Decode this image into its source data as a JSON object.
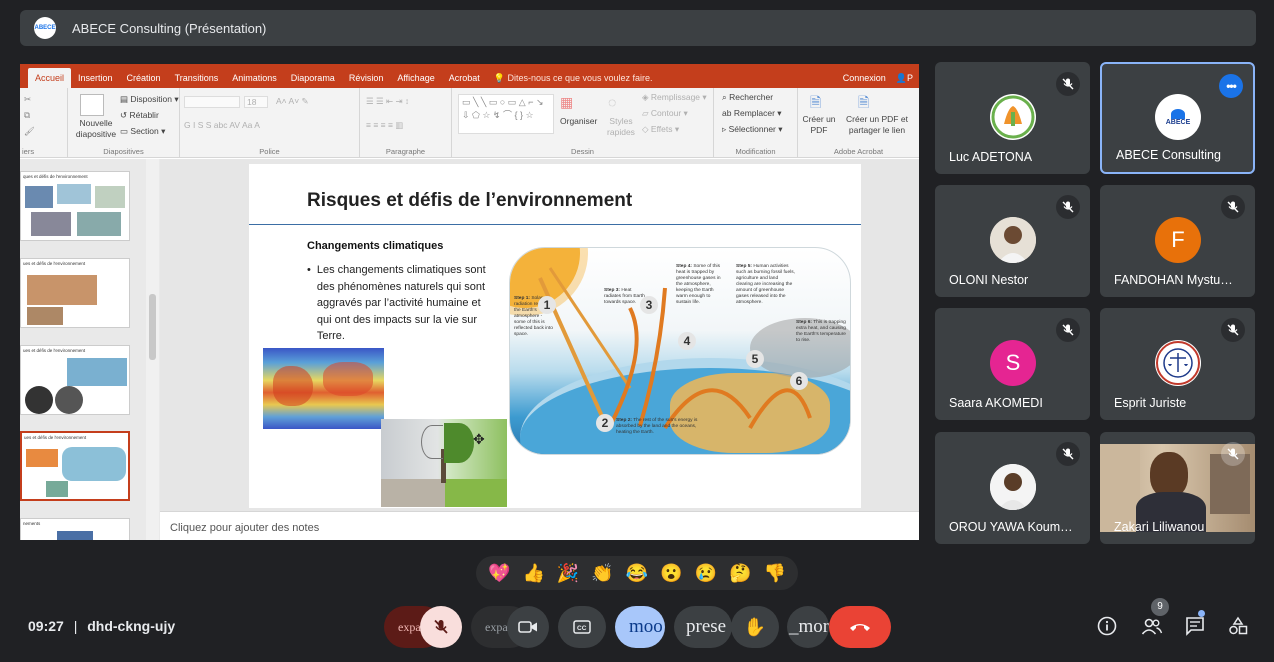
{
  "meeting": {
    "title": "ABECE Consulting (Présentation)",
    "time": "09:27",
    "separator": "|",
    "code": "dhd-ckng-ujy"
  },
  "ppt": {
    "tabs": [
      "Accueil",
      "Insertion",
      "Création",
      "Transitions",
      "Animations",
      "Diaporama",
      "Révision",
      "Affichage",
      "Acrobat"
    ],
    "search_hint": "Dites-nous ce que vous voulez faire.",
    "connect": "Connexion",
    "share_letter": "P",
    "ribbon": {
      "paste_group": "iers",
      "new_slide": "Nouvelle diapositive",
      "layout": "Disposition",
      "reset": "Rétablir",
      "section": "Section",
      "slides_group": "Diapositives",
      "font_group": "Police",
      "font_size": "18",
      "font_btns": "G  I  S  S  abc  AV  Aa  A",
      "para_group": "Paragraphe",
      "organize": "Organiser",
      "quick_styles": "Styles rapides",
      "fill": "Remplissage",
      "outline": "Contour",
      "effects": "Effets",
      "draw_group": "Dessin",
      "find": "Rechercher",
      "replace": "Remplacer",
      "select": "Sélectionner",
      "edit_group": "Modification",
      "create_pdf": "Créer un PDF",
      "create_pdf_share": "Créer un PDF et partager le lien",
      "acrobat_group": "Adobe Acrobat"
    },
    "thumbs": [
      {
        "title": "ques et défis de l'environnement"
      },
      {
        "title": "ues et défis de l'environnement"
      },
      {
        "title": "ues et défis de l'environnement"
      },
      {
        "title": "ues et défis de l'environnement"
      },
      {
        "title": "nements"
      }
    ],
    "slide": {
      "title": "Risques et défis de l’environnement",
      "subtitle": "Changements climatiques",
      "bullet": "Les changements climatiques sont des phénomènes naturels qui sont aggravés par l’activité humaine et qui ont des impacts sur la vie sur Terre.",
      "steps": [
        {
          "num": "1",
          "label": "Step 1:",
          "text": "Solar radiation reaches the Earth's atmosphere - some of this is reflected back into space."
        },
        {
          "num": "2",
          "label": "Step 2:",
          "text": "The rest of the sun's energy is absorbed by the land and the oceans, heating the Earth."
        },
        {
          "num": "3",
          "label": "Step 3:",
          "text": "Heat radiates from Earth towards space."
        },
        {
          "num": "4",
          "label": "Step 4:",
          "text": "Some of this heat is trapped by greenhouse gases in the atmosphere, keeping the Earth warm enough to sustain life."
        },
        {
          "num": "5",
          "label": "Step 5:",
          "text": "Human activities such as burning fossil fuels, agriculture and land clearing are increasing the amount of greenhouse gases released into the atmosphere."
        },
        {
          "num": "6",
          "label": "Step 6:",
          "text": "This is trapping extra heat, and causing the Earth's temperature to rise."
        }
      ]
    },
    "notes": "Cliquez pour ajouter des notes"
  },
  "participants": [
    {
      "name": "Luc ADETONA",
      "avatar": "logo",
      "color": "#ffffff",
      "muted": true
    },
    {
      "name": "ABECE Consulting",
      "avatar": "logo",
      "color": "#ffffff",
      "muted": false,
      "presenting": true,
      "logo_text": "ABECE"
    },
    {
      "name": "OLONI Nestor",
      "avatar": "photo",
      "color": "#d9d0c3",
      "muted": true
    },
    {
      "name": "FANDOHAN Mystu…",
      "avatar": "letter",
      "letter": "F",
      "color": "#e8710a",
      "muted": true
    },
    {
      "name": "Saara AKOMEDI",
      "avatar": "letter",
      "letter": "S",
      "color": "#e52592",
      "muted": true
    },
    {
      "name": "Esprit Juriste",
      "avatar": "logo",
      "color": "#ffffff",
      "muted": true
    },
    {
      "name": "OROU YAWA Koum…",
      "avatar": "photo",
      "color": "#f1f1f1",
      "muted": true
    },
    {
      "name": "Zakari Liliwanou",
      "avatar": "video",
      "color": "#8a6d55",
      "muted": true
    }
  ],
  "reactions": [
    "💖",
    "👍",
    "🎉",
    "👏",
    "😂",
    "😮",
    "😢",
    "🤔",
    "👎"
  ],
  "controls": {
    "expand_mic": "expa",
    "expand_cam": "expa",
    "mood": "moo",
    "present": "prese",
    "more": "_mor",
    "people_count": "9"
  },
  "colors": {
    "accent": "#8ab4f8",
    "end_call": "#ea4335",
    "mic_off": "#f9dedc",
    "ppt": "#c43e1c"
  }
}
